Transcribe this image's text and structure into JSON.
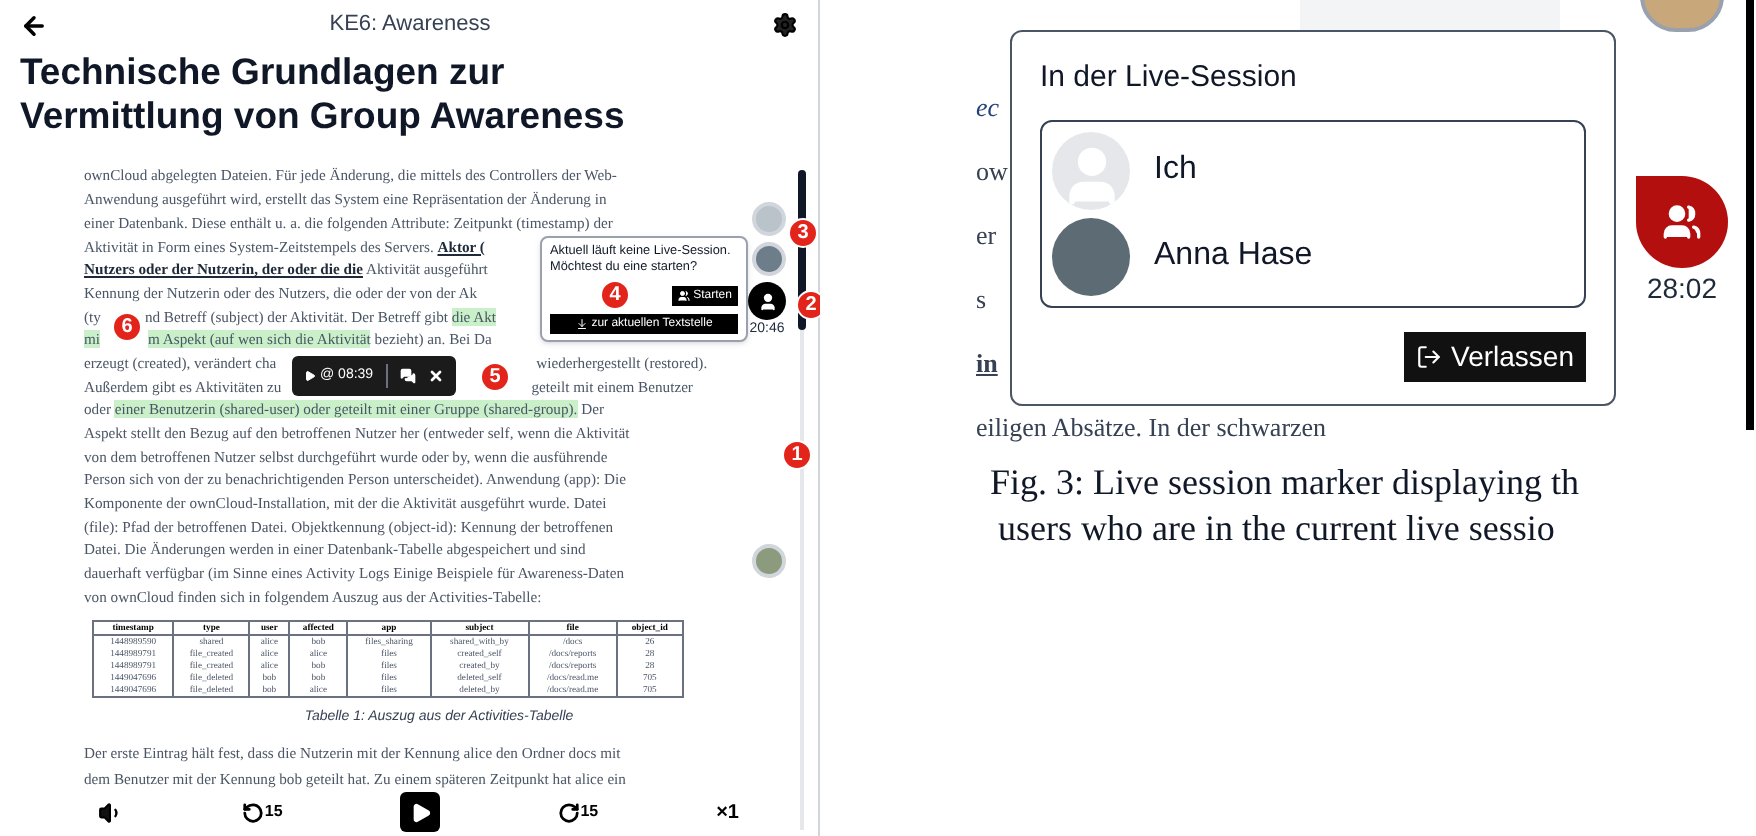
{
  "header": {
    "title": "KE6: Awareness"
  },
  "heading_lines": [
    "Technische Grundlagen zur",
    "Vermittlung von Group Awareness"
  ],
  "paragraph_lines": [
    {
      "runs": [
        [
          {
            "text": "ownCloud abgelegten Dateien. Für jede Änderung, die mittels des Controllers der Web-",
            "kind": "plain"
          }
        ]
      ]
    },
    {
      "runs": [
        [
          {
            "text": "Anwendung ausgeführt wird, erstellt das System eine Repräsentation der Änderung in",
            "kind": "plain"
          }
        ]
      ]
    },
    {
      "runs": [
        [
          {
            "text": "einer Datenbank. Diese enthält u. a. die folgenden Attribute: Zeitpunkt (timestamp) der",
            "kind": "plain"
          }
        ]
      ]
    },
    {
      "runs": [
        [
          {
            "text": "Aktivität in Form eines System-Zeitstempels des Servers. ",
            "kind": "plain"
          },
          {
            "text": "Aktor (",
            "kind": "link"
          }
        ]
      ]
    },
    {
      "runs": [
        [
          {
            "text": "Nutzers oder der Nutzerin, der oder die die",
            "kind": "link"
          },
          {
            "text": " Aktivität ausgeführt",
            "kind": "plain"
          }
        ]
      ]
    },
    {
      "runs": [
        [
          {
            "text": "Kennung der Nutzerin oder des Nutzers, die oder der von der Ak",
            "kind": "plain"
          }
        ]
      ]
    },
    {
      "runs": [
        [
          {
            "text": "(ty",
            "kind": "plain"
          }
        ],
        [
          {
            "text": "nd Betreff (subject) der Aktivität. Der Betreff gibt ",
            "kind": "plain"
          },
          {
            "text": "die Akt",
            "kind": "highlight"
          }
        ]
      ]
    },
    {
      "runs": [
        [
          {
            "text": "mi",
            "kind": "highlight"
          }
        ],
        [
          {
            "text": "m Aspekt (auf wen sich die Aktivität",
            "kind": "highlight"
          },
          {
            "text": " bezieht) an. Bei Da",
            "kind": "plain"
          }
        ]
      ]
    },
    {
      "runs": [
        [
          {
            "text": "erzeugt (created), verändert cha",
            "kind": "plain"
          }
        ],
        [
          {
            "text": "wiederhergestellt (restored).",
            "kind": "plain"
          }
        ]
      ]
    },
    {
      "runs": [
        [
          {
            "text": "Außerdem gibt es Aktivitäten zu",
            "kind": "plain"
          }
        ],
        [
          {
            "text": "geteilt mit einem Benutzer",
            "kind": "plain"
          }
        ]
      ]
    },
    {
      "runs": [
        [
          {
            "text": "oder ",
            "kind": "plain"
          },
          {
            "text": "einer Benutzerin (shared-user) oder geteilt mit einer Gruppe (shared-group).",
            "kind": "highlight"
          },
          {
            "text": " Der",
            "kind": "plain"
          }
        ]
      ]
    },
    {
      "runs": [
        [
          {
            "text": "Aspekt stellt den Bezug auf den betroffenen Nutzer her (entweder self, wenn die Aktivität",
            "kind": "plain"
          }
        ]
      ]
    },
    {
      "runs": [
        [
          {
            "text": "von dem betroffenen Nutzer selbst durchgeführt wurde oder by, wenn die ausführende",
            "kind": "plain"
          }
        ]
      ]
    },
    {
      "runs": [
        [
          {
            "text": "Person sich von der zu benachrichtigenden Person unterscheidet). Anwendung (app): Die",
            "kind": "plain"
          }
        ]
      ]
    },
    {
      "runs": [
        [
          {
            "text": "Komponente der ownCloud-Installation, mit der die Aktivität ausgeführt wurde. Datei",
            "kind": "plain"
          }
        ]
      ]
    },
    {
      "runs": [
        [
          {
            "text": "(file): Pfad der betroffenen Datei. Objektkennung (object-id): Kennung der betroffenen",
            "kind": "plain"
          }
        ]
      ]
    },
    {
      "runs": [
        [
          {
            "text": "Datei. Die Änderungen werden in einer Datenbank-Tabelle abgespeichert und sind",
            "kind": "plain"
          }
        ]
      ]
    },
    {
      "runs": [
        [
          {
            "text": "dauerhaft verfügbar (im Sinne eines Activity Logs Einige Beispiele für Awareness-Daten",
            "kind": "plain"
          }
        ]
      ]
    },
    {
      "runs": [
        [
          {
            "text": "von ownCloud finden sich in folgendem Auszug aus der Activities-Tabelle:",
            "kind": "plain"
          }
        ]
      ]
    }
  ],
  "table": {
    "columns": [
      "timestamp",
      "type",
      "user",
      "affected",
      "app",
      "subject",
      "file",
      "object_id"
    ],
    "rows": [
      [
        "1448989590",
        "shared",
        "alice",
        "bob",
        "files_sharing",
        "shared_with_by",
        "/docs",
        "26"
      ],
      [
        "1448989791",
        "file_created",
        "alice",
        "alice",
        "files",
        "created_self",
        "/docs/reports",
        "28"
      ],
      [
        "1448989791",
        "file_created",
        "alice",
        "bob",
        "files",
        "created_by",
        "/docs/reports",
        "28"
      ],
      [
        "1449047696",
        "file_deleted",
        "bob",
        "bob",
        "files",
        "deleted_self",
        "/docs/read.me",
        "705"
      ],
      [
        "1449047696",
        "file_deleted",
        "bob",
        "alice",
        "files",
        "deleted_by",
        "/docs/read.me",
        "705"
      ]
    ]
  },
  "table_caption": "Tabelle 1: Auszug aus der Activities-Tabelle",
  "closing_lines": [
    "Der erste Eintrag hält fest, dass die Nutzerin mit der Kennung alice den Ordner docs mit",
    "dem Benutzer mit der Kennung bob geteilt hat. Zu einem späteren Zeitpunkt hat alice ein"
  ],
  "player": {
    "skip_back": "15",
    "skip_forward": "15",
    "speed": "×1"
  },
  "user_marker": {
    "time": "20:46"
  },
  "badges": [
    "1",
    "2",
    "3",
    "4",
    "5",
    "6"
  ],
  "start_popup": {
    "message_lines": [
      "Aktuell läuft keine Live-Session.",
      "Möchtest du eine starten?"
    ],
    "start_button": "Starten",
    "jump_button": "zur aktuellen Textstelle"
  },
  "toolbar": {
    "play_time": "@ 08:39"
  },
  "figure": {
    "fragments": [
      {
        "text": "ec",
        "kind": "italic"
      },
      {
        "text": "ow",
        "kind": "plain"
      },
      {
        "text": "er",
        "kind": "plain"
      },
      {
        "text": "s",
        "kind": "plain"
      },
      {
        "text": "in",
        "kind": "link"
      },
      {
        "text": "eiligen Absätze. In der schwarzen",
        "kind": "plain"
      }
    ],
    "session_popup": {
      "title": "In der Live-Session",
      "participants": [
        {
          "name": "Ich",
          "kind": "placeholder"
        },
        {
          "name": "Anna Hase",
          "kind": "photo"
        }
      ],
      "leave_button": "Verlassen"
    },
    "marker_time": "28:02",
    "caption_lines": [
      "Fig. 3: Live session marker displaying th",
      "users who are in the current live sessio"
    ]
  }
}
